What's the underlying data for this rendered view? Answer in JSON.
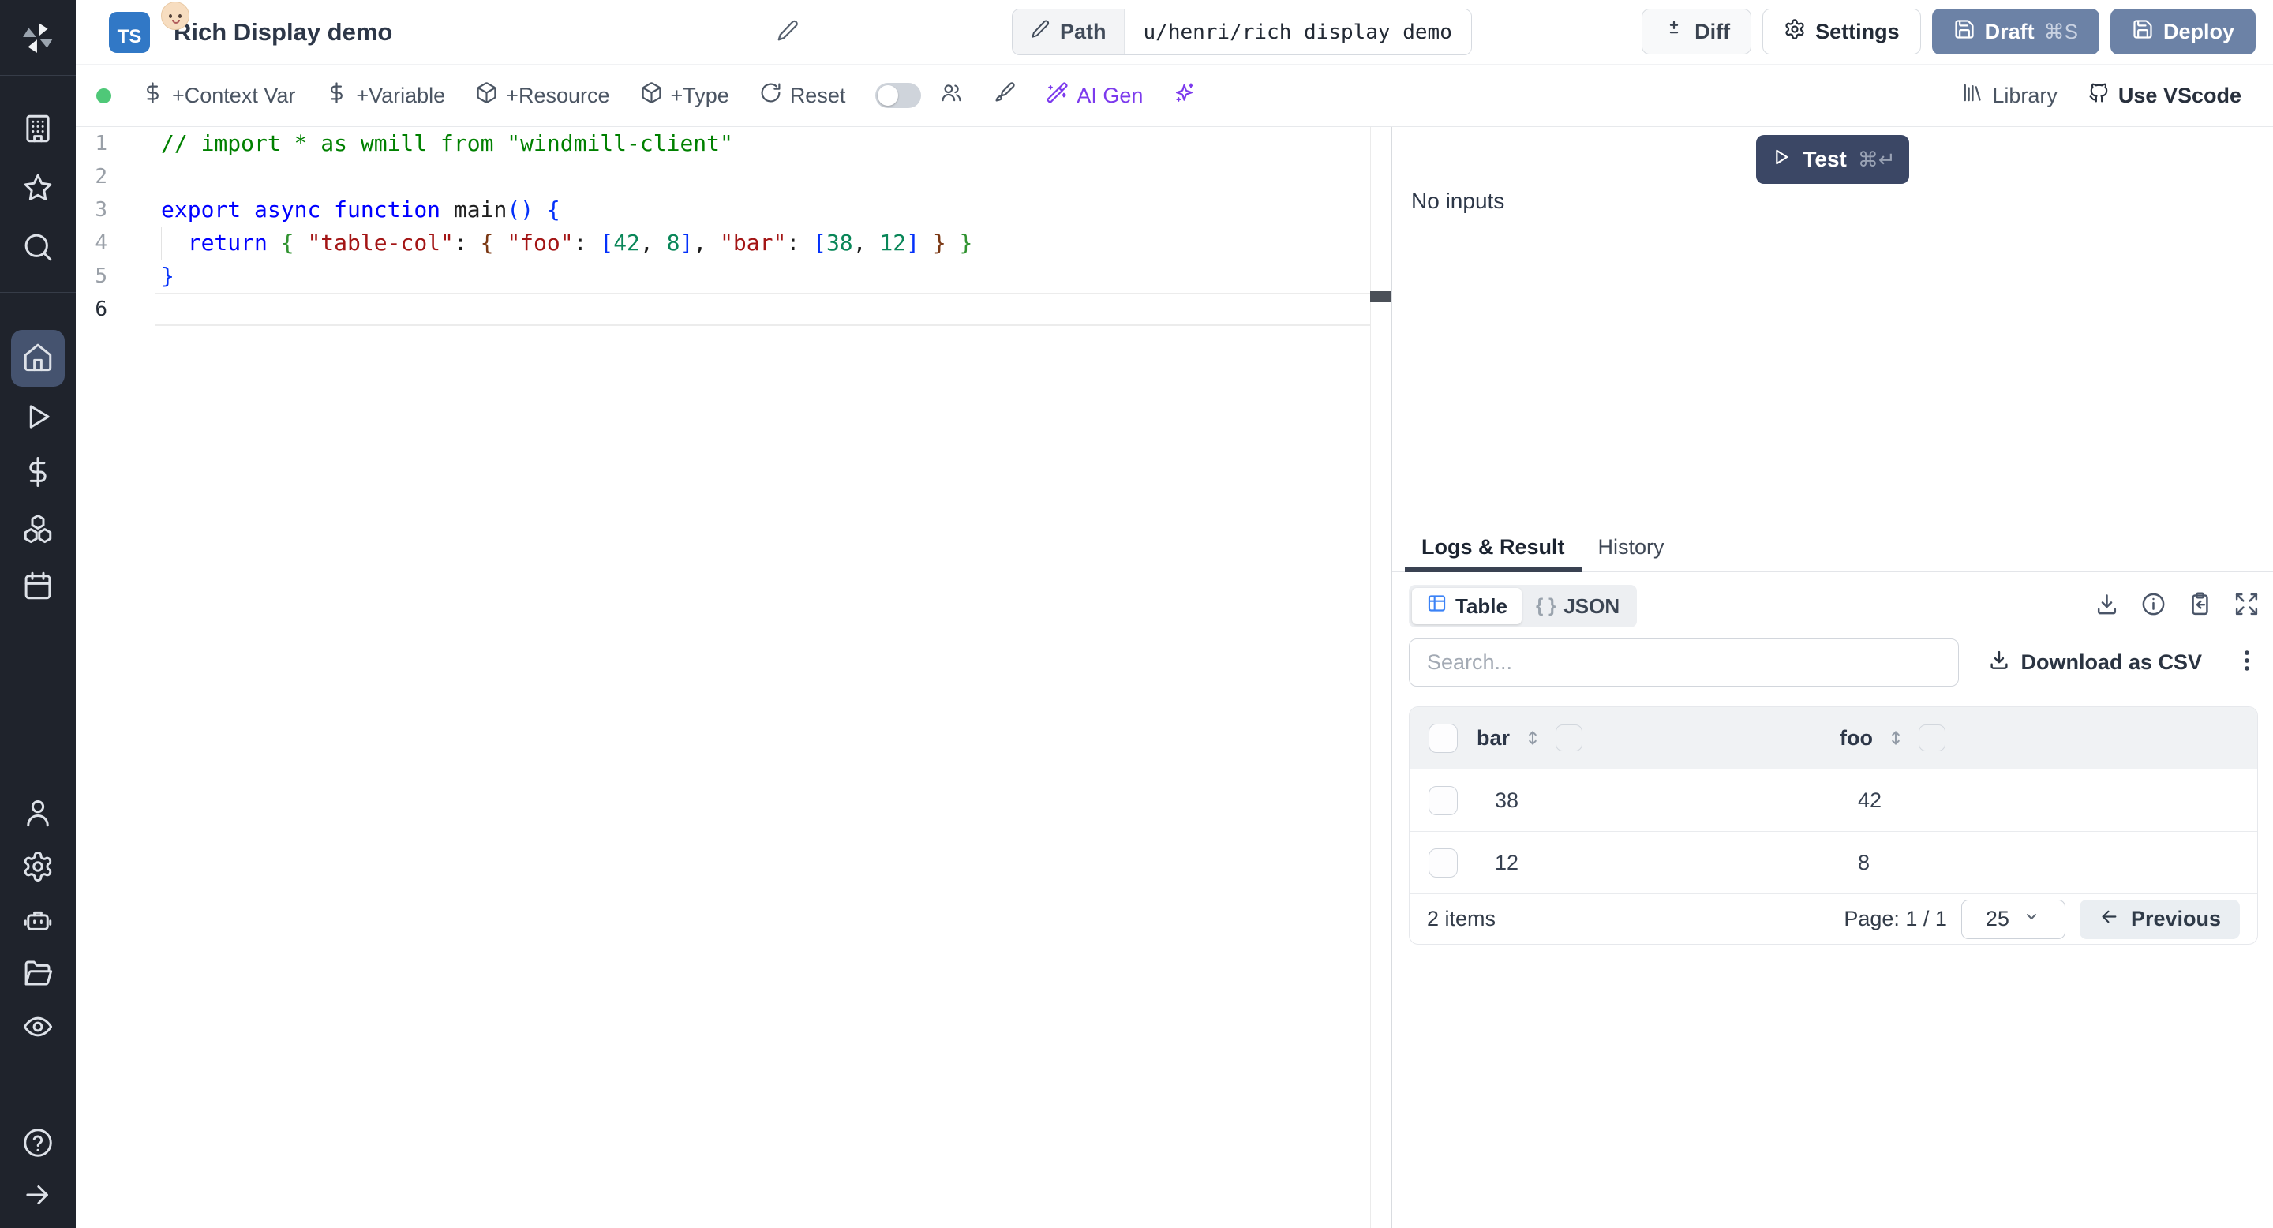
{
  "header": {
    "lang_badge": "TS",
    "title": "Rich Display demo",
    "path": {
      "label": "Path",
      "value": "u/henri/rich_display_demo"
    },
    "buttons": {
      "diff": "Diff",
      "settings": "Settings",
      "draft": "Draft",
      "draft_shortcut": "⌘S",
      "deploy": "Deploy"
    }
  },
  "toolbar": {
    "context_var": "+Context Var",
    "variable": "+Variable",
    "resource": "+Resource",
    "type": "+Type",
    "reset": "Reset",
    "ai_gen": "AI Gen",
    "library": "Library",
    "use_vscode": "Use VScode"
  },
  "editor": {
    "line_numbers": [
      "1",
      "2",
      "3",
      "4",
      "5",
      "6"
    ],
    "lines": [
      {
        "tokens": [
          {
            "t": "// import * as wmill from \"windmill-client\"",
            "c": "cmt"
          }
        ]
      },
      {
        "tokens": []
      },
      {
        "tokens": [
          {
            "t": "export",
            "c": "kw"
          },
          {
            "t": " ",
            "c": "pl"
          },
          {
            "t": "async",
            "c": "kw"
          },
          {
            "t": " ",
            "c": "pl"
          },
          {
            "t": "function",
            "c": "kw"
          },
          {
            "t": " ",
            "c": "pl"
          },
          {
            "t": "main",
            "c": "fn"
          },
          {
            "t": "(",
            "c": "b1"
          },
          {
            "t": ")",
            "c": "b1"
          },
          {
            "t": " ",
            "c": "pl"
          },
          {
            "t": "{",
            "c": "b1"
          }
        ]
      },
      {
        "tokens": [
          {
            "t": "  ",
            "c": "pl"
          },
          {
            "t": "return",
            "c": "kw"
          },
          {
            "t": " ",
            "c": "pl"
          },
          {
            "t": "{",
            "c": "b2"
          },
          {
            "t": " ",
            "c": "pl"
          },
          {
            "t": "\"table-col\"",
            "c": "str"
          },
          {
            "t": ": ",
            "c": "pl"
          },
          {
            "t": "{",
            "c": "b3"
          },
          {
            "t": " ",
            "c": "pl"
          },
          {
            "t": "\"foo\"",
            "c": "str"
          },
          {
            "t": ": ",
            "c": "pl"
          },
          {
            "t": "[",
            "c": "b1"
          },
          {
            "t": "42",
            "c": "num"
          },
          {
            "t": ", ",
            "c": "pl"
          },
          {
            "t": "8",
            "c": "num"
          },
          {
            "t": "]",
            "c": "b1"
          },
          {
            "t": ", ",
            "c": "pl"
          },
          {
            "t": "\"bar\"",
            "c": "str"
          },
          {
            "t": ": ",
            "c": "pl"
          },
          {
            "t": "[",
            "c": "b1"
          },
          {
            "t": "38",
            "c": "num"
          },
          {
            "t": ", ",
            "c": "pl"
          },
          {
            "t": "12",
            "c": "num"
          },
          {
            "t": "]",
            "c": "b1"
          },
          {
            "t": " ",
            "c": "pl"
          },
          {
            "t": "}",
            "c": "b3"
          },
          {
            "t": " ",
            "c": "pl"
          },
          {
            "t": "}",
            "c": "b2"
          }
        ]
      },
      {
        "tokens": [
          {
            "t": "}",
            "c": "b1"
          }
        ]
      },
      {
        "tokens": []
      }
    ]
  },
  "run_panel": {
    "test": "Test",
    "test_shortcut": "⌘↵",
    "no_inputs": "No inputs"
  },
  "result_panel": {
    "tabs": {
      "logs": "Logs & Result",
      "history": "History"
    },
    "view": {
      "table": "Table",
      "json_braces": "{ }",
      "json": "JSON"
    },
    "search_placeholder": "Search...",
    "download_csv": "Download as CSV",
    "table": {
      "columns": {
        "col1": "bar",
        "col2": "foo"
      },
      "rows": [
        {
          "bar": "38",
          "foo": "42"
        },
        {
          "bar": "12",
          "foo": "8"
        }
      ],
      "footer": {
        "items": "2 items",
        "page": "Page: 1 / 1",
        "page_size": "25",
        "previous": "Previous"
      }
    }
  },
  "colors": {
    "sidebar_bg": "#1f232c",
    "sidebar_active": "#45536f",
    "slate_button": "#6c82a6",
    "test_button": "#3b4765",
    "ai_purple": "#7c3aed",
    "status_green": "#4fc878",
    "table_icon_blue": "#3b82f6",
    "ts_badge_blue": "#3178c6"
  }
}
